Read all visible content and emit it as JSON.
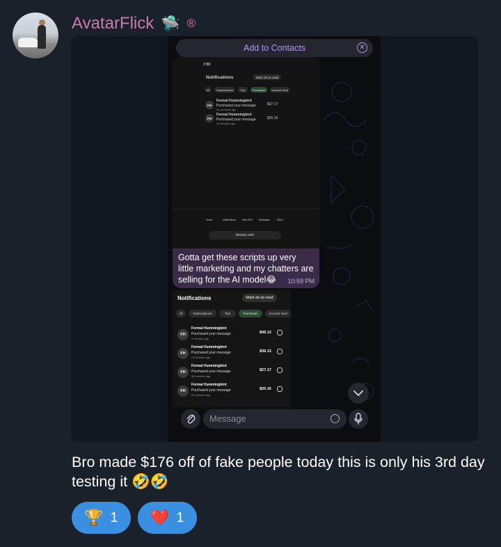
{
  "message": {
    "sender_name": "AvatarFlick",
    "sender_emoji": "🛸",
    "sender_mark": "®",
    "caption": "Bro made $176 off of fake people today this is only his 3rd day testing it 🤣🤣",
    "reactions": [
      {
        "emoji": "🏆",
        "count": "1"
      },
      {
        "emoji": "❤️",
        "count": "1"
      }
    ]
  },
  "media": {
    "add_contacts_label": "Add to Contacts",
    "close_glyph": "✕",
    "composer_placeholder": "Message",
    "inner_bubble": {
      "text": "Gotta get these scripts up very little marketing and my chatters are selling for the AI model😂",
      "time": "10:59 PM"
    },
    "screenshot1": {
      "status_time": "7:59",
      "title": "Notifications",
      "mark_all": "Mark all as read",
      "tabs": [
        "All",
        "Subscriptions",
        "Tips",
        "Purchases",
        "Account Heal"
      ],
      "rows": [
        {
          "initials": "FH",
          "name": "Formal Hummingbird",
          "msg": "Purchased your message",
          "ago": "21 seconds ago",
          "amount": "$27.17"
        },
        {
          "initials": "FH",
          "name": "Formal Hummingbird",
          "msg": "Purchased your message",
          "ago": "12 minutes ago",
          "amount": "$20.16"
        }
      ],
      "nav": [
        "Home",
        "Notifications",
        "New Post",
        "Messages",
        "Menu"
      ],
      "url": "fanvue.com"
    },
    "screenshot2": {
      "title": "Notifications",
      "mark_all": "Mark all as read",
      "tabs": [
        "All",
        "Subscriptions",
        "Tips",
        "Purchases",
        "Account Heal"
      ],
      "rows": [
        {
          "initials": "FH",
          "name": "Formal Hummingbird",
          "msg": "Purchased your message",
          "ago": "9 minutes ago",
          "amount": "$46.13"
        },
        {
          "initials": "FH",
          "name": "Formal Hummingbird",
          "msg": "Purchased your message",
          "ago": "21 minutes ago",
          "amount": "$36.13"
        },
        {
          "initials": "FH",
          "name": "Formal Hummingbird",
          "msg": "Purchased your message",
          "ago": "38 minutes ago",
          "amount": "$27.17"
        },
        {
          "initials": "FH",
          "name": "Formal Hummingbird",
          "msg": "Purchased your message",
          "ago": "51 minutes ago",
          "amount": "$20.16"
        }
      ]
    }
  },
  "colors": {
    "background": "#1b212b",
    "sender": "#c97bb0",
    "accent_purple": "#b994f3",
    "bubble": "#3a2c49",
    "reaction": "#3b8fe0"
  }
}
